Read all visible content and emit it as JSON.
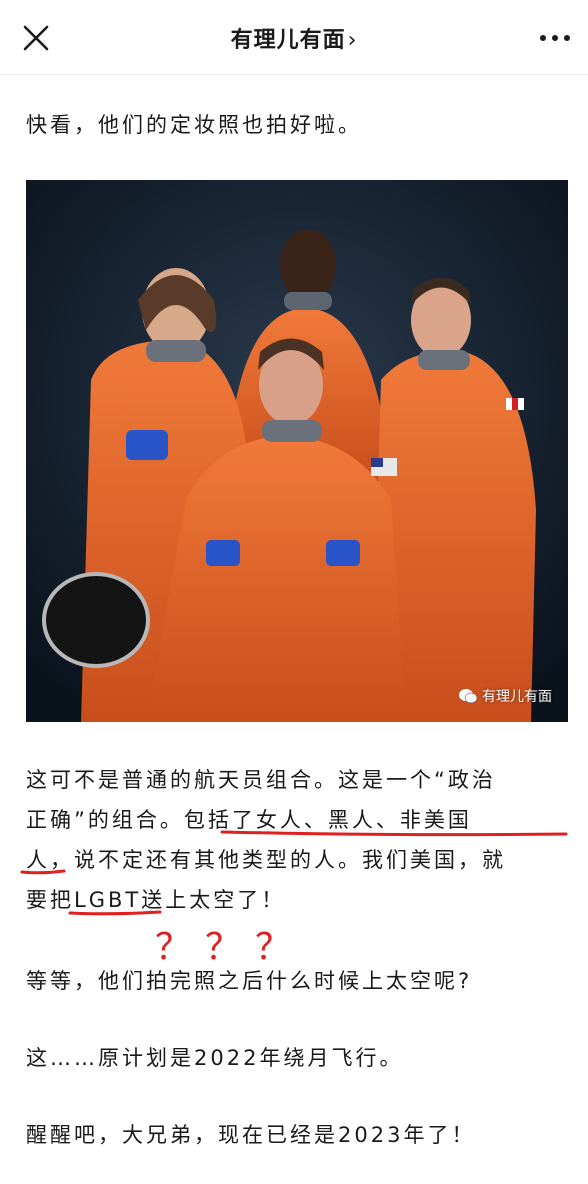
{
  "header": {
    "title": "有理儿有面",
    "chevron": "›",
    "close_icon": "close-icon",
    "more_icon": "more-icon"
  },
  "article": {
    "intro": "快看，他们的定妆照也拍好啦。",
    "photo_watermark": "有理儿有面",
    "body_line1": "这可不是普通的航天员组合。这是一个“政治",
    "body_line2a": "正确”的组合。",
    "body_line2b": "包括了女人、黑人、非美国",
    "body_line3a": "人，",
    "body_line3b": "说不定还有其他类型的人。我们美国，就",
    "body_line4a": "要把",
    "body_line4b": "LGBT",
    "body_line4c": "送上太空了！",
    "question_marks": "？？？",
    "para2": "等等，他们拍完照之后什么时候上太空呢?",
    "para3": "这……原计划是2022年绕月飞行。",
    "para4": "醒醒吧，大兄弟，现在已经是2023年了！"
  },
  "colors": {
    "annotation_red": "#e02020",
    "suit_orange": "#e2622a",
    "background_dark": "#0f1a28"
  }
}
